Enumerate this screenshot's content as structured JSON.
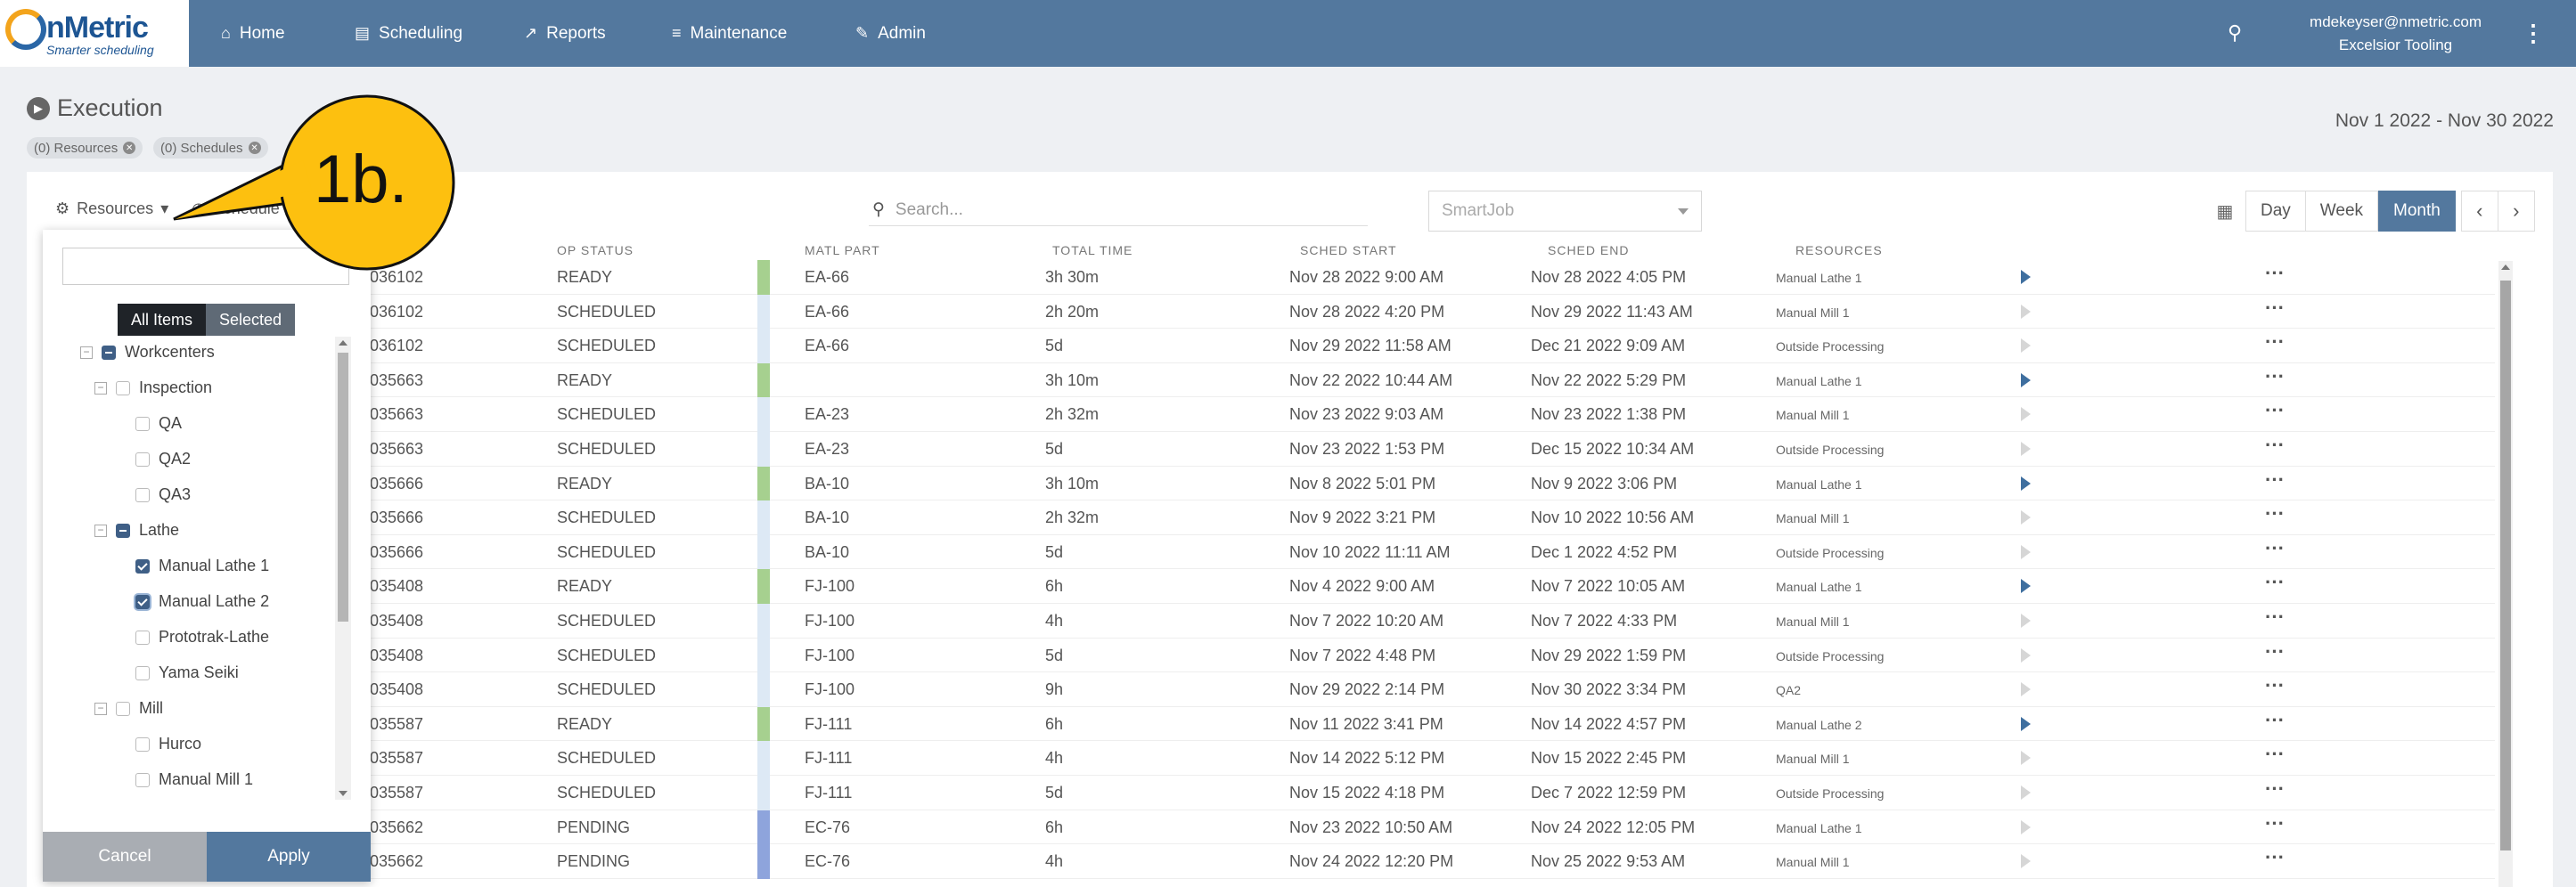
{
  "brand": {
    "name": "nMetric",
    "tagline": "Smarter scheduling"
  },
  "nav": {
    "items": [
      {
        "label": "Home",
        "icon": "home-icon"
      },
      {
        "label": "Scheduling",
        "icon": "calendar-list-icon"
      },
      {
        "label": "Reports",
        "icon": "chart-icon"
      },
      {
        "label": "Maintenance",
        "icon": "sliders-icon"
      },
      {
        "label": "Admin",
        "icon": "edit-icon"
      }
    ],
    "user_email": "mdekeyser@nmetric.com",
    "company": "Excelsior Tooling"
  },
  "page": {
    "title": "Execution",
    "date_range": "Nov 1 2022 - Nov 30 2022",
    "chips": [
      "(0) Resources",
      "(0) Schedules"
    ]
  },
  "toolbar": {
    "resources_label": "Resources",
    "schedules_label": "Schedule",
    "search_placeholder": "Search...",
    "smartjob_placeholder": "SmartJob",
    "views": [
      "Day",
      "Week",
      "Month"
    ],
    "active_view": "Month"
  },
  "table": {
    "headers": {
      "op_status": "OP STATUS",
      "matl_part": "MATL PART",
      "total_time": "TOTAL TIME",
      "sched_start": "SCHED START",
      "sched_end": "SCHED END",
      "resources": "RESOURCES"
    },
    "rows": [
      {
        "job": "036102",
        "status": "READY",
        "part": "EA-66",
        "time": "3h 30m",
        "start": "Nov 28 2022 9:00 AM",
        "end": "Nov 28 2022 4:05 PM",
        "resource": "Manual Lathe 1",
        "color": "#a6d08f",
        "play": true
      },
      {
        "job": "036102",
        "status": "SCHEDULED",
        "part": "EA-66",
        "time": "2h 20m",
        "start": "Nov 28 2022 4:20 PM",
        "end": "Nov 29 2022 11:43 AM",
        "resource": "Manual Mill 1",
        "color": "#dde9f5",
        "play": false
      },
      {
        "job": "036102",
        "status": "SCHEDULED",
        "part": "EA-66",
        "time": "5d",
        "start": "Nov 29 2022 11:58 AM",
        "end": "Dec 21 2022 9:09 AM",
        "resource": "Outside Processing",
        "color": "#dde9f5",
        "play": false
      },
      {
        "job": "035663",
        "status": "READY",
        "part": "",
        "time": "3h 10m",
        "start": "Nov 22 2022 10:44 AM",
        "end": "Nov 22 2022 5:29 PM",
        "resource": "Manual Lathe 1",
        "color": "#a6d08f",
        "play": true
      },
      {
        "job": "035663",
        "status": "SCHEDULED",
        "part": "EA-23",
        "time": "2h 32m",
        "start": "Nov 23 2022 9:03 AM",
        "end": "Nov 23 2022 1:38 PM",
        "resource": "Manual Mill 1",
        "color": "#dde9f5",
        "play": false
      },
      {
        "job": "035663",
        "status": "SCHEDULED",
        "part": "EA-23",
        "time": "5d",
        "start": "Nov 23 2022 1:53 PM",
        "end": "Dec 15 2022 10:34 AM",
        "resource": "Outside Processing",
        "color": "#dde9f5",
        "play": false
      },
      {
        "job": "035666",
        "status": "READY",
        "part": "BA-10",
        "time": "3h 10m",
        "start": "Nov 8 2022 5:01 PM",
        "end": "Nov 9 2022 3:06 PM",
        "resource": "Manual Lathe 1",
        "color": "#a6d08f",
        "play": true
      },
      {
        "job": "035666",
        "status": "SCHEDULED",
        "part": "BA-10",
        "time": "2h 32m",
        "start": "Nov 9 2022 3:21 PM",
        "end": "Nov 10 2022 10:56 AM",
        "resource": "Manual Mill 1",
        "color": "#dde9f5",
        "play": false
      },
      {
        "job": "035666",
        "status": "SCHEDULED",
        "part": "BA-10",
        "time": "5d",
        "start": "Nov 10 2022 11:11 AM",
        "end": "Dec 1 2022 4:52 PM",
        "resource": "Outside Processing",
        "color": "#dde9f5",
        "play": false
      },
      {
        "job": "035408",
        "status": "READY",
        "part": "FJ-100",
        "time": "6h",
        "start": "Nov 4 2022 9:00 AM",
        "end": "Nov 7 2022 10:05 AM",
        "resource": "Manual Lathe 1",
        "color": "#a6d08f",
        "play": true
      },
      {
        "job": "035408",
        "status": "SCHEDULED",
        "part": "FJ-100",
        "time": "4h",
        "start": "Nov 7 2022 10:20 AM",
        "end": "Nov 7 2022 4:33 PM",
        "resource": "Manual Mill 1",
        "color": "#dde9f5",
        "play": false
      },
      {
        "job": "035408",
        "status": "SCHEDULED",
        "part": "FJ-100",
        "time": "5d",
        "start": "Nov 7 2022 4:48 PM",
        "end": "Nov 29 2022 1:59 PM",
        "resource": "Outside Processing",
        "color": "#dde9f5",
        "play": false
      },
      {
        "job": "035408",
        "status": "SCHEDULED",
        "part": "FJ-100",
        "time": "9h",
        "start": "Nov 29 2022 2:14 PM",
        "end": "Nov 30 2022 3:34 PM",
        "resource": "QA2",
        "color": "#dde9f5",
        "play": false
      },
      {
        "job": "035587",
        "status": "READY",
        "part": "FJ-111",
        "time": "6h",
        "start": "Nov 11 2022 3:41 PM",
        "end": "Nov 14 2022 4:57 PM",
        "resource": "Manual Lathe 2",
        "color": "#a6d08f",
        "play": true
      },
      {
        "job": "035587",
        "status": "SCHEDULED",
        "part": "FJ-111",
        "time": "4h",
        "start": "Nov 14 2022 5:12 PM",
        "end": "Nov 15 2022 2:45 PM",
        "resource": "Manual Mill 1",
        "color": "#dde9f5",
        "play": false
      },
      {
        "job": "035587",
        "status": "SCHEDULED",
        "part": "FJ-111",
        "time": "5d",
        "start": "Nov 15 2022 4:18 PM",
        "end": "Dec 7 2022 12:59 PM",
        "resource": "Outside Processing",
        "color": "#dde9f5",
        "play": false
      },
      {
        "job": "035662",
        "status": "PENDING",
        "part": "EC-76",
        "time": "6h",
        "start": "Nov 23 2022 10:50 AM",
        "end": "Nov 24 2022 12:05 PM",
        "resource": "Manual Lathe 1",
        "color": "#8ea4dc",
        "play": false
      },
      {
        "job": "035662",
        "status": "PENDING",
        "part": "EC-76",
        "time": "4h",
        "start": "Nov 24 2022 12:20 PM",
        "end": "Nov 25 2022 9:53 AM",
        "resource": "Manual Mill 1",
        "color": "#8ea4dc",
        "play": false
      }
    ]
  },
  "resource_popup": {
    "tabs": [
      "All Items",
      "Selected"
    ],
    "tree": [
      {
        "label": "Workcenters",
        "level": 0,
        "expander": "−",
        "state": "partial"
      },
      {
        "label": "Inspection",
        "level": 1,
        "expander": "−",
        "state": "none"
      },
      {
        "label": "QA",
        "level": 2,
        "expander": "",
        "state": "none"
      },
      {
        "label": "QA2",
        "level": 2,
        "expander": "",
        "state": "none"
      },
      {
        "label": "QA3",
        "level": 2,
        "expander": "",
        "state": "none"
      },
      {
        "label": "Lathe",
        "level": 1,
        "expander": "−",
        "state": "partial"
      },
      {
        "label": "Manual Lathe 1",
        "level": 2,
        "expander": "",
        "state": "checked"
      },
      {
        "label": "Manual Lathe 2",
        "level": 2,
        "expander": "",
        "state": "checked-focus"
      },
      {
        "label": "Prototrak-Lathe",
        "level": 2,
        "expander": "",
        "state": "none"
      },
      {
        "label": "Yama Seiki",
        "level": 2,
        "expander": "",
        "state": "none"
      },
      {
        "label": "Mill",
        "level": 1,
        "expander": "−",
        "state": "none"
      },
      {
        "label": "Hurco",
        "level": 2,
        "expander": "",
        "state": "none"
      },
      {
        "label": "Manual Mill 1",
        "level": 2,
        "expander": "",
        "state": "none"
      }
    ],
    "cancel_label": "Cancel",
    "apply_label": "Apply"
  },
  "annotation": {
    "label": "1b.",
    "fill": "#fdc00f"
  },
  "colors": {
    "nav_bg": "#53789e",
    "accent": "#53789e",
    "ready": "#a6d08f",
    "scheduled": "#dde9f5",
    "pending": "#8ea4dc"
  }
}
